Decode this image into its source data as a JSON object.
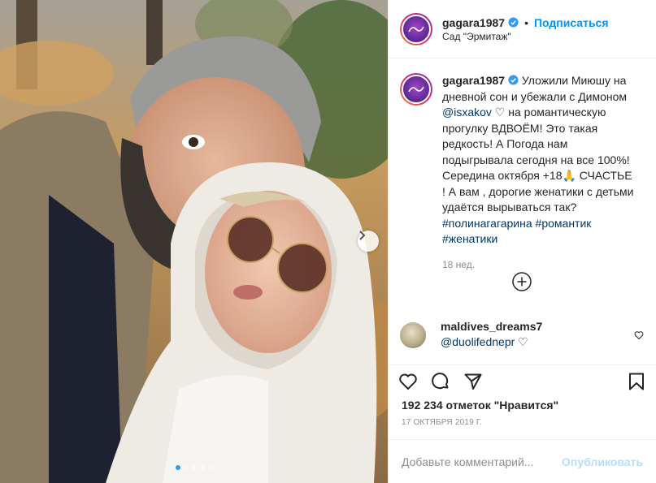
{
  "header": {
    "username": "gagara1987",
    "separator": "•",
    "follow_label": "Подписаться",
    "location": "Сад \"Эрмитаж\"",
    "icons": {
      "verified": "verified-badge-icon"
    }
  },
  "caption": {
    "username": "gagara1987",
    "text_1": " Уложили Миюшу на дневной сон и убежали с Димоном ",
    "mention": "@isxakov",
    "heart": "♡",
    "text_2": " на романтическую прогулку ВДВОЁМ! Это такая редкость! А Погода нам подыгрывала сегодня на все 100%! Середина октября +18🙏 СЧАСТЬЕ ! А вам , дорогие женатики с детьми удаётся вырываться так?",
    "hashtag_1": "#полинагагарина",
    "hashtag_2": "#романтик",
    "hashtag_3": "#женатики",
    "time": "18 нед."
  },
  "comment": {
    "username": "maldives_dreams7",
    "mention": "@duolifednepr",
    "heart": "♡"
  },
  "stats": {
    "likes": "192 234 отметок \"Нравится\"",
    "date": "17 ОКТЯБРЯ 2019 Г."
  },
  "add_comment": {
    "placeholder": "Добавьте комментарий...",
    "post_label": "Опубликовать"
  },
  "carousel": {
    "slides": 5,
    "active_index": 0
  },
  "colors": {
    "accent": "#0095f6",
    "post_disabled": "#b2dffc",
    "muted": "#8e8e8e",
    "active_dot": "#3897f0"
  },
  "icons": [
    "heart-icon",
    "comment-icon",
    "share-icon",
    "bookmark-icon",
    "more-comments-icon",
    "chevron-right-icon",
    "like-comment-icon"
  ]
}
